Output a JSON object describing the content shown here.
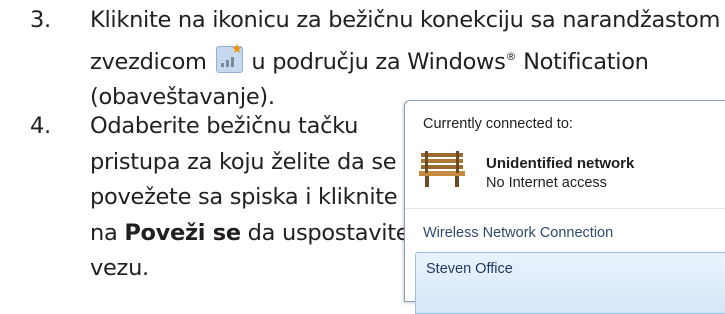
{
  "steps": [
    {
      "number": "3.",
      "line1": "Kliknite na ikonicu za bežičnu konekciju sa narandžastom",
      "line2_before": "zvezdicom",
      "line2_after": "u području za Windows",
      "registered": "®",
      "line2_end": "Notification",
      "line3": "(obaveštavanje)."
    },
    {
      "number": "4.",
      "line1": "Odaberite bežičnu tačku",
      "line2": "pristupa za koju želite da se",
      "line3": "povežete sa spiska i kliknite",
      "line4_prefix": "na",
      "line4_bold": "Poveži se",
      "line4_suffix": "da uspostavite",
      "line5": "vezu."
    }
  ],
  "icons": {
    "wireless_tray": "wireless-signal-icon-with-orange-star",
    "network": "bench-icon"
  },
  "popup": {
    "header": "Currently connected to:",
    "network_name": "Unidentified network",
    "network_status": "No Internet access",
    "section_label": "Wireless Network Connection",
    "network_item": "Steven Office"
  },
  "colors": {
    "text": "#231f20",
    "star": "#f39200",
    "link_blue": "#2e4a6e",
    "selection_bg": "#d6e7f9"
  }
}
